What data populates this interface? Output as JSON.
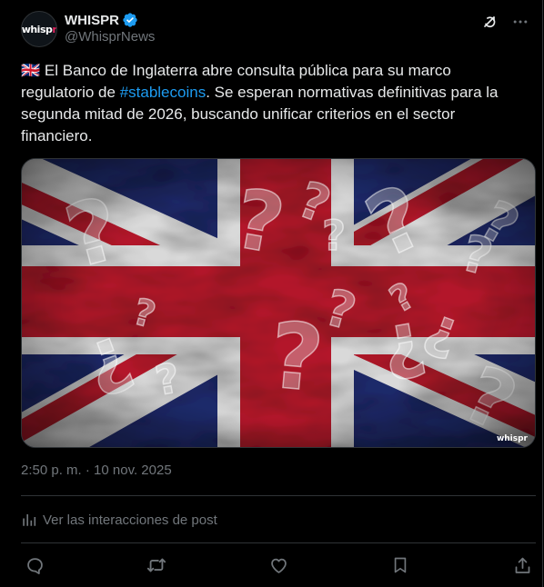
{
  "author": {
    "display_name": "WHISPR",
    "handle": "@WhisprNews",
    "avatar_text": "whisp",
    "avatar_text_accent": "r",
    "verified_icon": "verified-badge-icon"
  },
  "header_actions": {
    "grok_icon": "grok-icon",
    "more_icon": "more-icon"
  },
  "post": {
    "flag_emoji": "🇬🇧",
    "text_before": " El Banco de Inglaterra abre consulta pública para su marco regulatorio de ",
    "hashtag": "#stablecoins",
    "text_after": ". Se esperan normativas definitivas para la segunda mitad de 2026, buscando unificar criterios en el sector financiero."
  },
  "media": {
    "watermark": "whispr",
    "description_icon": "union-jack-question-marks-image"
  },
  "meta": {
    "timestamp": "2:50 p. m. · 10 nov. 2025"
  },
  "analytics": {
    "label": "Ver las interacciones de post",
    "icon": "analytics-icon"
  },
  "actions": {
    "reply_icon": "reply-icon",
    "repost_icon": "repost-icon",
    "like_icon": "like-icon",
    "bookmark_icon": "bookmark-icon",
    "share_icon": "share-icon"
  },
  "colors": {
    "background": "#000000",
    "text_primary": "#e7e9ea",
    "text_secondary": "#71767b",
    "accent": "#1d9bf0",
    "border": "#2f3336",
    "flag_blue": "#1f2a6b",
    "flag_red": "#b3192a",
    "flag_white": "#d9d9d9"
  }
}
